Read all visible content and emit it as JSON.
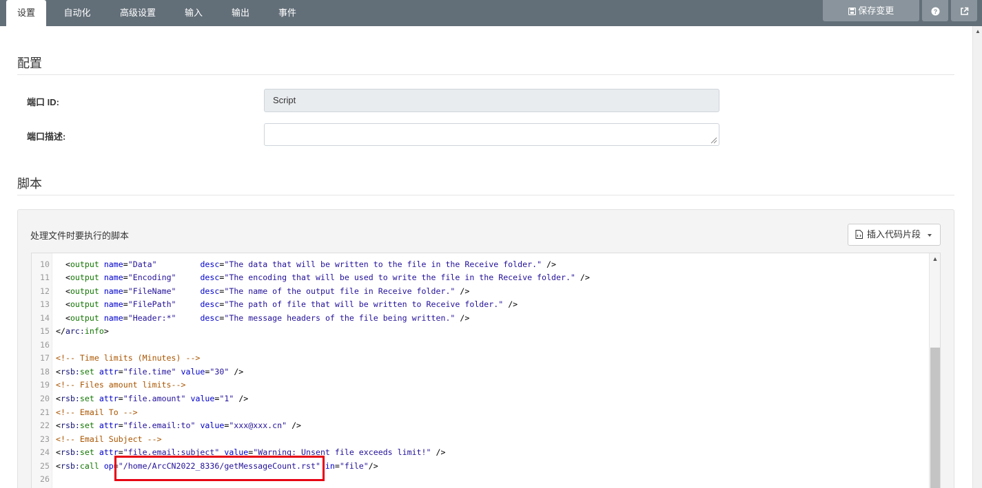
{
  "tabs": [
    {
      "label": "设置",
      "active": true
    },
    {
      "label": "自动化"
    },
    {
      "label": "高级设置"
    },
    {
      "label": "输入"
    },
    {
      "label": "输出"
    },
    {
      "label": "事件"
    }
  ],
  "toolbar": {
    "save_label": "保存变更",
    "help_icon": "question-icon",
    "external_icon": "external-link-icon"
  },
  "config": {
    "heading": "配置",
    "port_id_label": "端口 ID:",
    "port_id_value": "Script",
    "port_desc_label": "端口描述:",
    "port_desc_value": ""
  },
  "script": {
    "heading": "脚本",
    "panel_title": "处理文件时要执行的脚本",
    "insert_snippet_label": "插入代码片段"
  },
  "code_lines": [
    {
      "n": "10",
      "text": "  <output name=\"Data\"         desc=\"The data that will be written to the file in the Receive folder.\" />"
    },
    {
      "n": "11",
      "text": "  <output name=\"Encoding\"     desc=\"The encoding that will be used to write the file in the Receive folder.\" />"
    },
    {
      "n": "12",
      "text": "  <output name=\"FileName\"     desc=\"The name of the output file in Receive folder.\" />"
    },
    {
      "n": "13",
      "text": "  <output name=\"FilePath\"     desc=\"The path of file that will be written to Receive folder.\" />"
    },
    {
      "n": "14",
      "text": "  <output name=\"Header:*\"     desc=\"The message headers of the file being written.\" />"
    },
    {
      "n": "15",
      "text": "</arc:info>"
    },
    {
      "n": "16",
      "text": ""
    },
    {
      "n": "17",
      "text": "<!-- Time limits (Minutes) -->"
    },
    {
      "n": "18",
      "text": "<rsb:set attr=\"file.time\" value=\"30\" />"
    },
    {
      "n": "19",
      "text": "<!-- Files amount limits-->"
    },
    {
      "n": "20",
      "text": "<rsb:set attr=\"file.amount\" value=\"1\" />"
    },
    {
      "n": "21",
      "text": "<!-- Email To -->"
    },
    {
      "n": "22",
      "text": "<rsb:set attr=\"file.email:to\" value=\"xxx@xxx.cn\" />"
    },
    {
      "n": "23",
      "text": "<!-- Email Subject -->"
    },
    {
      "n": "24",
      "text": "<rsb:set attr=\"file.email:subject\" value=\"Warning: Unsent file exceeds limit!\" />"
    },
    {
      "n": "25",
      "text": "<rsb:call op=\"/home/ArcCN2022_8336/getMessageCount.rst\" in=\"file\"/>"
    },
    {
      "n": "26",
      "text": ""
    }
  ],
  "colors": {
    "topbar": "#626e78",
    "highlight": "#e60012"
  }
}
